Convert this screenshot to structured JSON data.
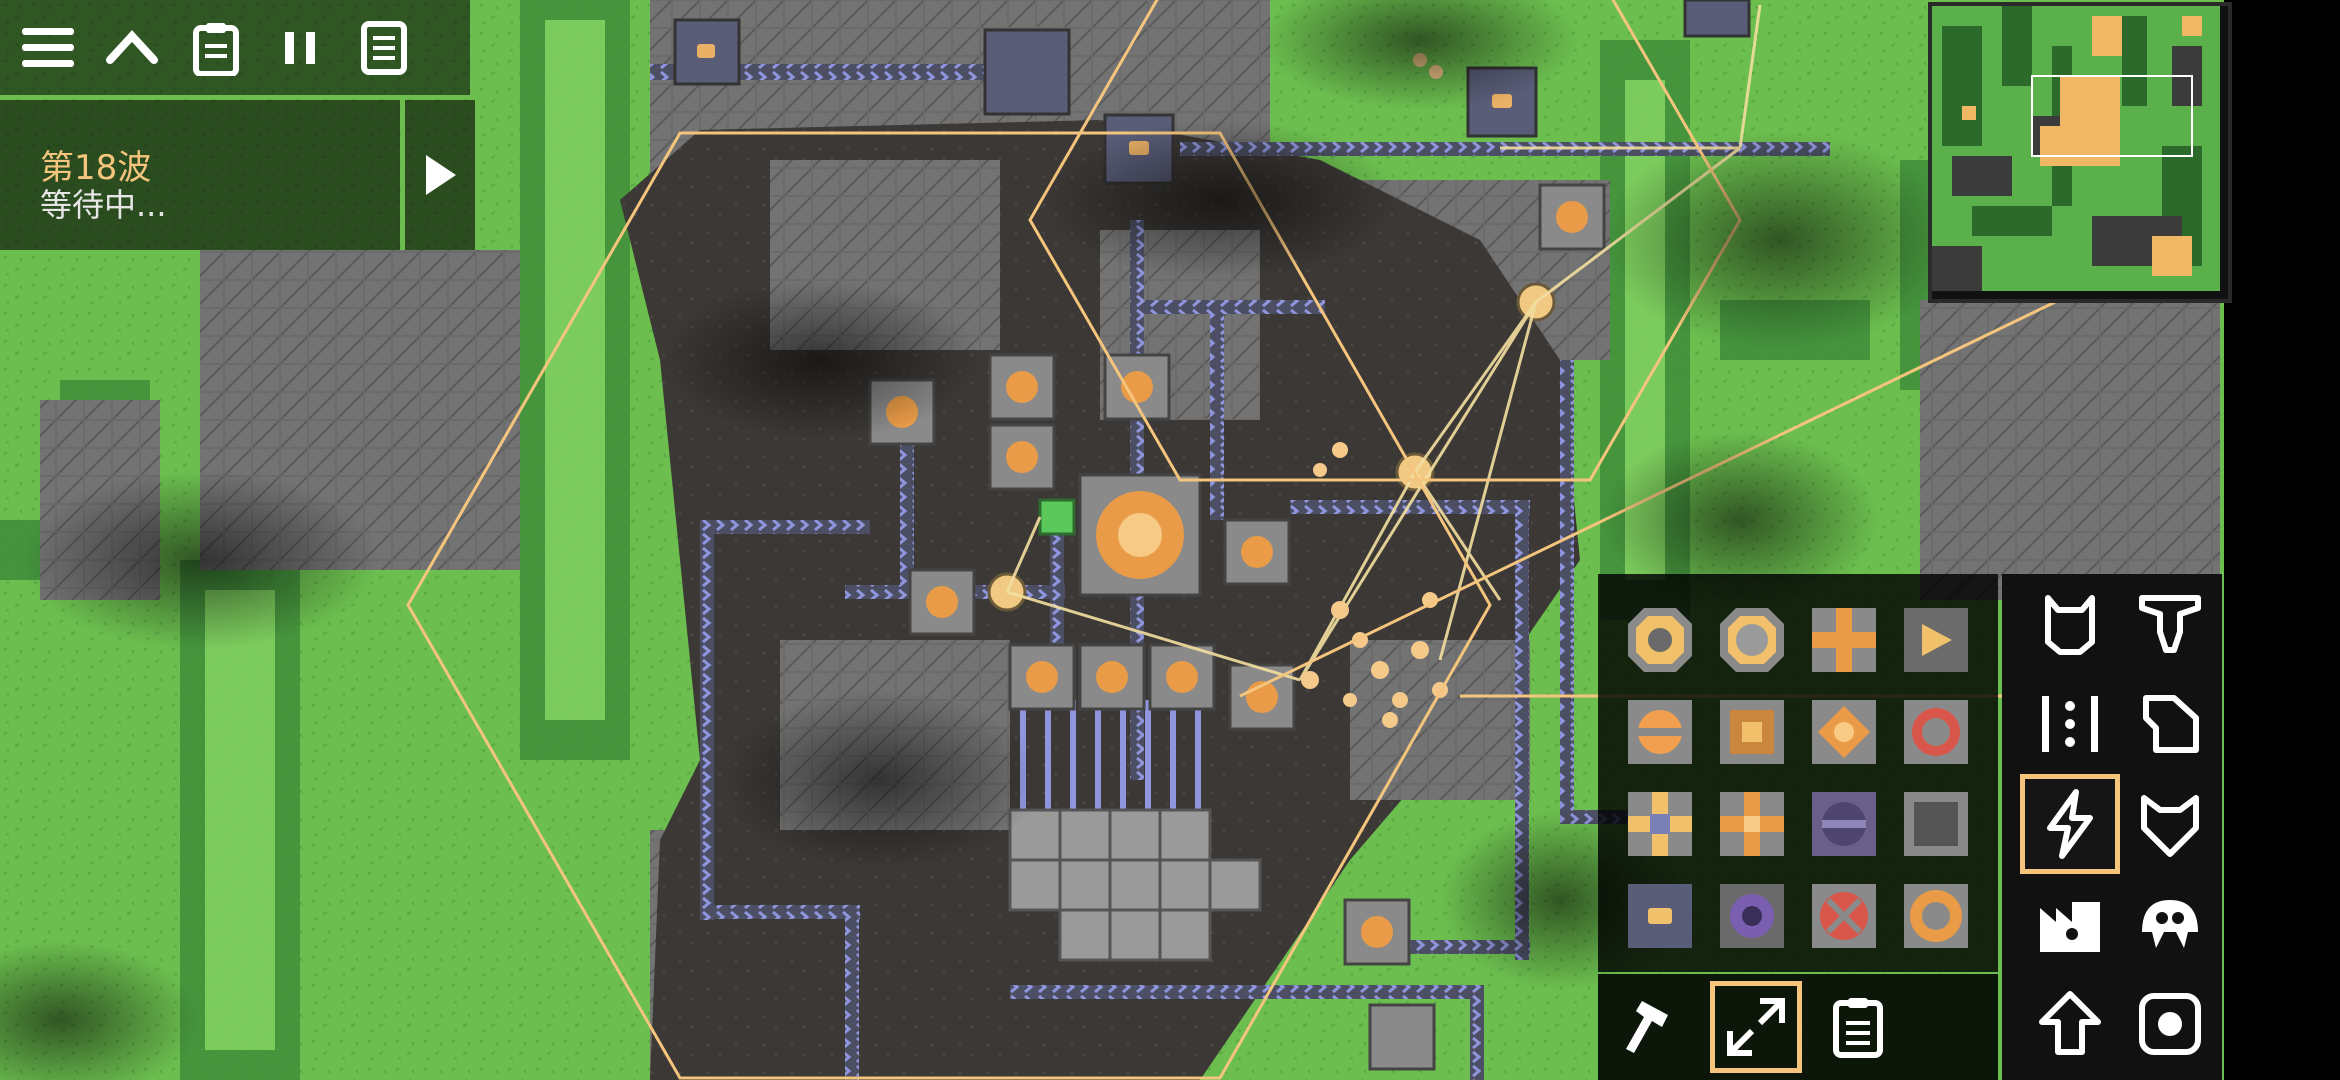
{
  "colors": {
    "grass": "#6cbf4f",
    "grass_dark": "#3e8a3a",
    "grass_light": "#84d25e",
    "rock": "#6d6d6d",
    "rock_dark": "#4a4a4a",
    "dirt": "#3a3532",
    "accent": "#f5c57d",
    "conveyor": "#8f96dd",
    "ui_bg": "#000000"
  },
  "top_bar": {
    "buttons": [
      {
        "name": "menu-button",
        "icon": "hamburger-icon"
      },
      {
        "name": "collapse-button",
        "icon": "chevron-up-icon"
      },
      {
        "name": "database-button",
        "icon": "clipboard-icon"
      },
      {
        "name": "pause-button",
        "icon": "pause-icon"
      },
      {
        "name": "objectives-button",
        "icon": "list-icon"
      }
    ]
  },
  "wave": {
    "title": "第18波",
    "status": "等待中..."
  },
  "minimap": {
    "icon": "minimap"
  },
  "block_palette": [
    {
      "name": "battery-block",
      "icon": "battery-icon"
    },
    {
      "name": "large-battery-block",
      "icon": "large-battery-icon"
    },
    {
      "name": "diode-block",
      "icon": "diode-icon"
    },
    {
      "name": "power-node-block",
      "icon": "power-node-icon"
    },
    {
      "name": "generator-block",
      "icon": "combustion-generator-icon"
    },
    {
      "name": "steam-generator-block",
      "icon": "steam-generator-icon"
    },
    {
      "name": "differential-generator-block",
      "icon": "differential-generator-icon"
    },
    {
      "name": "rtg-generator-block",
      "icon": "rtg-generator-icon"
    },
    {
      "name": "solar-panel-block",
      "icon": "solar-panel-icon"
    },
    {
      "name": "large-solar-panel-block",
      "icon": "large-solar-panel-icon"
    },
    {
      "name": "thorium-reactor-block",
      "icon": "thorium-reactor-icon"
    },
    {
      "name": "impact-reactor-block",
      "icon": "impact-reactor-icon"
    },
    {
      "name": "power-source-block",
      "icon": "power-source-icon"
    },
    {
      "name": "power-void-block",
      "icon": "power-void-icon"
    },
    {
      "name": "surge-tower-block",
      "icon": "surge-tower-icon"
    },
    {
      "name": "laser-drill-block",
      "icon": "laser-drill-icon"
    }
  ],
  "categories": [
    {
      "name": "category-turret",
      "icon": "turret-icon",
      "selected": false
    },
    {
      "name": "category-production",
      "icon": "drill-icon",
      "selected": false
    },
    {
      "name": "category-distribution",
      "icon": "conveyor-icon",
      "selected": false
    },
    {
      "name": "category-liquid",
      "icon": "liquid-icon",
      "selected": false
    },
    {
      "name": "category-power",
      "icon": "lightning-icon",
      "selected": true
    },
    {
      "name": "category-defense",
      "icon": "shield-icon",
      "selected": false
    },
    {
      "name": "category-crafting",
      "icon": "factory-icon",
      "selected": false
    },
    {
      "name": "category-units",
      "icon": "unit-icon",
      "selected": false
    },
    {
      "name": "category-effect",
      "icon": "arrow-up-icon",
      "selected": false
    },
    {
      "name": "category-logic",
      "icon": "logic-icon",
      "selected": false
    }
  ],
  "tools": [
    {
      "name": "hammer-tool",
      "icon": "hammer-icon",
      "selected": false
    },
    {
      "name": "expand-tool",
      "icon": "expand-icon",
      "selected": true
    },
    {
      "name": "schematic-tool",
      "icon": "clipboard-icon",
      "selected": false
    }
  ]
}
